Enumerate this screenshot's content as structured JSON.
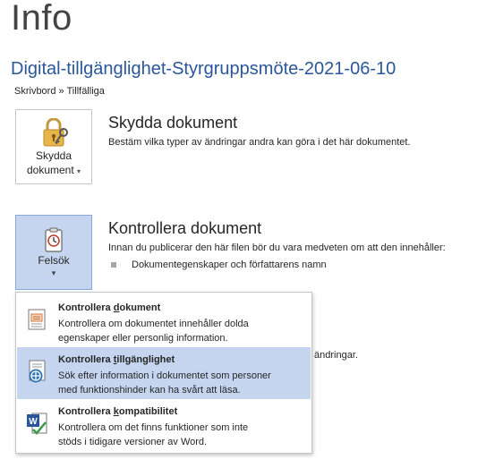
{
  "page": {
    "title": "Info"
  },
  "document": {
    "title": "Digital-tillgänglighet-Styrgruppsmöte-2021-06-10",
    "breadcrumb": "Skrivbord » Tillfälliga"
  },
  "protect": {
    "button_line1": "Skydda",
    "button_line2": "dokument",
    "heading": "Skydda dokument",
    "description": "Bestäm vilka typer av ändringar andra kan göra i det här dokumentet."
  },
  "inspect": {
    "button_label": "Felsök",
    "heading": "Kontrollera dokument",
    "description": "Innan du publicerar den här filen bör du vara medveten om att den innehåller:",
    "bullet": "Dokumentegenskaper och författarens namn",
    "partial_text": "ändringar."
  },
  "menu": {
    "items": [
      {
        "title_pre": "Kontrollera ",
        "title_key": "d",
        "title_post": "okument",
        "line1": "Kontrollera om dokumentet innehåller dolda",
        "line2": "egenskaper eller personlig information.",
        "icon": "inspect-document-icon"
      },
      {
        "title_pre": "Kontrollera ",
        "title_key": "t",
        "title_post": "illgänglighet",
        "line1": "Sök efter information i dokumentet som personer",
        "line2": "med funktionshinder kan ha svårt att läsa.",
        "icon": "accessibility-icon"
      },
      {
        "title_pre": "Kontrollera ",
        "title_key": "k",
        "title_post": "ompatibilitet",
        "line1": "Kontrollera om det finns funktioner som inte",
        "line2": "stöds i tidigare versioner av Word.",
        "icon": "word-compatibility-icon"
      }
    ]
  },
  "colors": {
    "accent": "#2b579a",
    "hover": "#c5d5ef",
    "active_border": "#8aa7d8"
  }
}
